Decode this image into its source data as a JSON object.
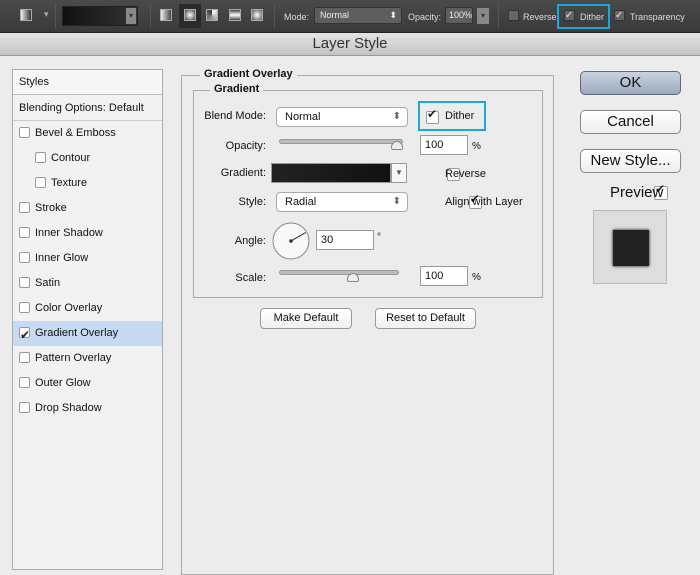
{
  "toolbar": {
    "mode_label": "Mode:",
    "mode_value": "Normal",
    "opacity_label": "Opacity:",
    "opacity_value": "100%",
    "reverse": "Reverse",
    "dither": "Dither",
    "transparency": "Transparency",
    "highlight_color": "#1aa7dc"
  },
  "dialog": {
    "title": "Layer Style"
  },
  "sidebar": {
    "header": "Styles",
    "items": [
      {
        "label": "Blending Options: Default",
        "checkbox": false
      },
      {
        "label": "Bevel & Emboss",
        "checkbox": true,
        "checked": false
      },
      {
        "label": "Contour",
        "checkbox": true,
        "checked": false,
        "indent": true
      },
      {
        "label": "Texture",
        "checkbox": true,
        "checked": false,
        "indent": true
      },
      {
        "label": "Stroke",
        "checkbox": true,
        "checked": false
      },
      {
        "label": "Inner Shadow",
        "checkbox": true,
        "checked": false
      },
      {
        "label": "Inner Glow",
        "checkbox": true,
        "checked": false
      },
      {
        "label": "Satin",
        "checkbox": true,
        "checked": false
      },
      {
        "label": "Color Overlay",
        "checkbox": true,
        "checked": false
      },
      {
        "label": "Gradient Overlay",
        "checkbox": true,
        "checked": true,
        "selected": true
      },
      {
        "label": "Pattern Overlay",
        "checkbox": true,
        "checked": false
      },
      {
        "label": "Outer Glow",
        "checkbox": true,
        "checked": false
      },
      {
        "label": "Drop Shadow",
        "checkbox": true,
        "checked": false
      }
    ]
  },
  "panel": {
    "group_title": "Gradient Overlay",
    "sub_title": "Gradient",
    "blend_mode_label": "Blend Mode:",
    "blend_mode": "Normal",
    "dither": "Dither",
    "opacity_label": "Opacity:",
    "opacity": "100",
    "opacity_unit": "%",
    "opacity_percent": 100,
    "gradient_label": "Gradient:",
    "reverse": "Reverse",
    "style_label": "Style:",
    "style": "Radial",
    "align": "Align with Layer",
    "angle_label": "Angle:",
    "angle": "30",
    "angle_unit": "°",
    "scale_label": "Scale:",
    "scale": "100",
    "scale_unit": "%",
    "make_default": "Make Default",
    "reset_default": "Reset to Default"
  },
  "buttons": {
    "ok": "OK",
    "cancel": "Cancel",
    "new_style": "New Style...",
    "preview": "Preview"
  }
}
